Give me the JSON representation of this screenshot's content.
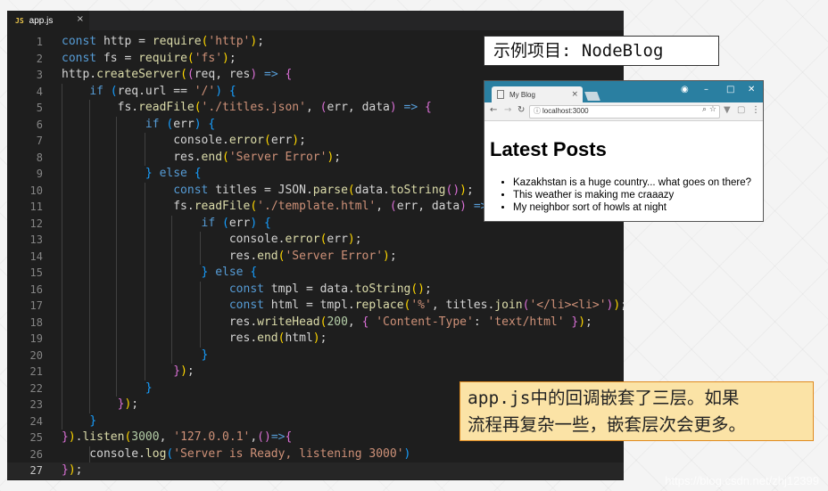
{
  "editor": {
    "tab": {
      "icon": "JS",
      "name": "app.js",
      "close": "×"
    },
    "lines": [
      {
        "n": "1",
        "html": "<span class=\"k\">const</span> http = <span class=\"f\">require</span><span class=\"b1\">(</span><span class=\"s\">'http'</span><span class=\"b1\">)</span>;"
      },
      {
        "n": "2",
        "html": "<span class=\"k\">const</span> fs = <span class=\"f\">require</span><span class=\"b1\">(</span><span class=\"s\">'fs'</span><span class=\"b1\">)</span>;"
      },
      {
        "n": "3",
        "html": "http.<span class=\"f\">createServer</span><span class=\"b1\">(</span><span class=\"b2\">(</span>req, res<span class=\"b2\">)</span> <span class=\"k\">=&gt;</span> <span class=\"b2\">{</span>"
      },
      {
        "n": "4",
        "html": "    <span class=\"k\">if</span> <span class=\"b3\">(</span>req.url == <span class=\"s\">'/'</span><span class=\"b3\">)</span> <span class=\"b3\">{</span>"
      },
      {
        "n": "5",
        "html": "        fs.<span class=\"f\">readFile</span><span class=\"b1\">(</span><span class=\"s\">'./titles.json'</span>, <span class=\"b2\">(</span>err, data<span class=\"b2\">)</span> <span class=\"k\">=&gt;</span> <span class=\"b2\">{</span>"
      },
      {
        "n": "6",
        "html": "            <span class=\"k\">if</span> <span class=\"b3\">(</span>err<span class=\"b3\">)</span> <span class=\"b3\">{</span>"
      },
      {
        "n": "7",
        "html": "                console.<span class=\"f\">error</span><span class=\"b1\">(</span>err<span class=\"b1\">)</span>;"
      },
      {
        "n": "8",
        "html": "                res.<span class=\"f\">end</span><span class=\"b1\">(</span><span class=\"s\">'Server Error'</span><span class=\"b1\">)</span>;"
      },
      {
        "n": "9",
        "html": "            <span class=\"b3\">}</span> <span class=\"k\">else</span> <span class=\"b3\">{</span>"
      },
      {
        "n": "10",
        "html": "                <span class=\"k\">const</span> titles = JSON.<span class=\"f\">parse</span><span class=\"b1\">(</span>data.<span class=\"f\">toString</span><span class=\"b2\">()</span><span class=\"b1\">)</span>;"
      },
      {
        "n": "11",
        "html": "                fs.<span class=\"f\">readFile</span><span class=\"b1\">(</span><span class=\"s\">'./template.html'</span>, <span class=\"b2\">(</span>err, data<span class=\"b2\">)</span> <span class=\"k\">=&gt;</span>"
      },
      {
        "n": "12",
        "html": "                    <span class=\"k\">if</span> <span class=\"b3\">(</span>err<span class=\"b3\">)</span> <span class=\"b3\">{</span>"
      },
      {
        "n": "13",
        "html": "                        console.<span class=\"f\">error</span><span class=\"b1\">(</span>err<span class=\"b1\">)</span>;"
      },
      {
        "n": "14",
        "html": "                        res.<span class=\"f\">end</span><span class=\"b1\">(</span><span class=\"s\">'Server Error'</span><span class=\"b1\">)</span>;"
      },
      {
        "n": "15",
        "html": "                    <span class=\"b3\">}</span> <span class=\"k\">else</span> <span class=\"b3\">{</span>"
      },
      {
        "n": "16",
        "html": "                        <span class=\"k\">const</span> tmpl = data.<span class=\"f\">toString</span><span class=\"b1\">()</span>;"
      },
      {
        "n": "17",
        "html": "                        <span class=\"k\">const</span> html = tmpl.<span class=\"f\">replace</span><span class=\"b1\">(</span><span class=\"s\">'%'</span>, titles.<span class=\"f\">join</span><span class=\"b2\">(</span><span class=\"s\">'&lt;/li&gt;&lt;li&gt;'</span><span class=\"b2\">)</span><span class=\"b1\">)</span>;"
      },
      {
        "n": "18",
        "html": "                        res.<span class=\"f\">writeHead</span><span class=\"b1\">(</span><span class=\"n\">200</span>, <span class=\"b2\">{</span> <span class=\"s\">'Content-Type'</span>: <span class=\"s\">'text/html'</span> <span class=\"b2\">}</span><span class=\"b1\">)</span>;"
      },
      {
        "n": "19",
        "html": "                        res.<span class=\"f\">end</span><span class=\"b1\">(</span>html<span class=\"b1\">)</span>;"
      },
      {
        "n": "20",
        "html": "                    <span class=\"b3\">}</span>"
      },
      {
        "n": "21",
        "html": "                <span class=\"b2\">}</span><span class=\"b1\">)</span>;"
      },
      {
        "n": "22",
        "html": "            <span class=\"b3\">}</span>"
      },
      {
        "n": "23",
        "html": "        <span class=\"b2\">}</span><span class=\"b1\">)</span>;"
      },
      {
        "n": "24",
        "html": "    <span class=\"b3\">}</span>"
      },
      {
        "n": "25",
        "html": "<span class=\"b2\">}</span><span class=\"b1\">)</span>.<span class=\"f\">listen</span><span class=\"b1\">(</span><span class=\"n\">3000</span>, <span class=\"s\">'127.0.0.1'</span>,<span class=\"b2\">()</span><span class=\"k\">=&gt;</span><span class=\"b2\">{</span>"
      },
      {
        "n": "26",
        "html": "    console.<span class=\"f\">log</span><span class=\"b3\">(</span><span class=\"s\">'Server is Ready, listening 3000'</span><span class=\"b3\">)</span>"
      },
      {
        "n": "27",
        "html": "<span class=\"b2\">}</span><span class=\"b1\">)</span>;"
      }
    ]
  },
  "label_title": "示例项目: NodeBlog",
  "browser": {
    "tab_title": "My Blog",
    "tab_close": "×",
    "url": "localhost:3000",
    "window_controls": [
      "–",
      "□",
      "✕"
    ],
    "heading": "Latest Posts",
    "posts": [
      "Kazakhstan is a huge country... what goes on there?",
      "This weather is making me craaazy",
      "My neighbor sort of howls at night"
    ]
  },
  "note": {
    "line1": "app.js中的回调嵌套了三层。如果",
    "line2": "流程再复杂一些，嵌套层次会更多。"
  },
  "watermark": "https://blog.csdn.net/zhj12399",
  "colors": {
    "editor_bg": "#1e1e1e",
    "browser_titlebar": "#2a7fa1",
    "note_bg": "#fbe3a6",
    "note_border": "#e08a1e"
  }
}
